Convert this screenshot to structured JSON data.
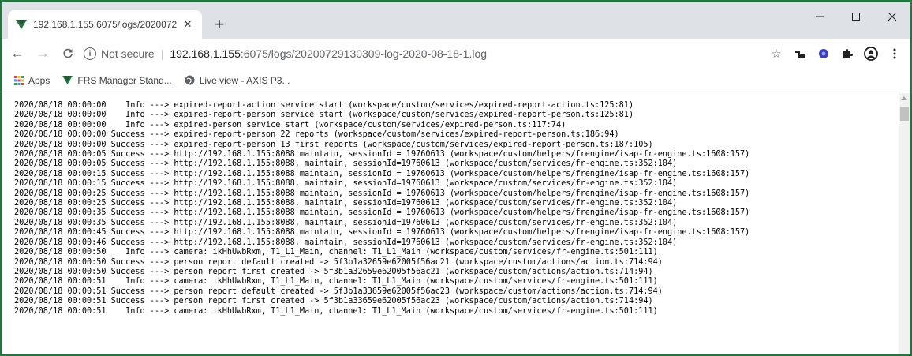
{
  "tab": {
    "title": "192.168.1.155:6075/logs/2020072",
    "close": "✕",
    "new_tab": "+"
  },
  "window_controls": {
    "minimize": "—",
    "maximize": "☐",
    "close": "✕"
  },
  "toolbar": {
    "back": "←",
    "forward": "→",
    "reload": "C",
    "not_secure": "Not secure",
    "separator": "|",
    "url_host": "192.168.1.155",
    "url_path": ":6075/logs/20200729130309-log-2020-08-18-1.log"
  },
  "bookmarks": {
    "apps": "Apps",
    "frs": "FRS Manager Stand...",
    "live": "Live view - AXIS P3..."
  },
  "log_lines": [
    "2020/08/18 00:00:00    Info ---> expired-report-action service start (workspace/custom/services/expired-report-action.ts:125:81)",
    "2020/08/18 00:00:00    Info ---> expired-report-person service start (workspace/custom/services/expired-report-person.ts:125:81)",
    "2020/08/18 00:00:00    Info ---> expired-person service start (workspace/custom/services/expired-person.ts:117:74)",
    "2020/08/18 00:00:00 Success ---> expired-report-person 22 reports (workspace/custom/services/expired-report-person.ts:186:94)",
    "2020/08/18 00:00:00 Success ---> expired-report-person 13 first reports (workspace/custom/services/expired-report-person.ts:187:105)",
    "2020/08/18 00:00:05 Success ---> http://192.168.1.155:8088 maintain, sessionId = 19760613 (workspace/custom/helpers/frengine/isap-fr-engine.ts:1608:157)",
    "2020/08/18 00:00:05 Success ---> http://192.168.1.155:8088, maintain, sessionId=19760613 (workspace/custom/services/fr-engine.ts:352:104)",
    "2020/08/18 00:00:15 Success ---> http://192.168.1.155:8088 maintain, sessionId = 19760613 (workspace/custom/helpers/frengine/isap-fr-engine.ts:1608:157)",
    "2020/08/18 00:00:15 Success ---> http://192.168.1.155:8088, maintain, sessionId=19760613 (workspace/custom/services/fr-engine.ts:352:104)",
    "2020/08/18 00:00:25 Success ---> http://192.168.1.155:8088 maintain, sessionId = 19760613 (workspace/custom/helpers/frengine/isap-fr-engine.ts:1608:157)",
    "2020/08/18 00:00:25 Success ---> http://192.168.1.155:8088, maintain, sessionId=19760613 (workspace/custom/services/fr-engine.ts:352:104)",
    "2020/08/18 00:00:35 Success ---> http://192.168.1.155:8088 maintain, sessionId = 19760613 (workspace/custom/helpers/frengine/isap-fr-engine.ts:1608:157)",
    "2020/08/18 00:00:35 Success ---> http://192.168.1.155:8088, maintain, sessionId=19760613 (workspace/custom/services/fr-engine.ts:352:104)",
    "2020/08/18 00:00:45 Success ---> http://192.168.1.155:8088 maintain, sessionId = 19760613 (workspace/custom/helpers/frengine/isap-fr-engine.ts:1608:157)",
    "2020/08/18 00:00:46 Success ---> http://192.168.1.155:8088, maintain, sessionId=19760613 (workspace/custom/services/fr-engine.ts:352:104)",
    "2020/08/18 00:00:50    Info ---> camera: ikHhUwbRxm, T1_L1_Main, channel: T1_L1_Main (workspace/custom/services/fr-engine.ts:501:111)",
    "2020/08/18 00:00:50 Success ---> person report default created -> 5f3b1a32659e62005f56ac21 (workspace/custom/actions/action.ts:714:94)",
    "2020/08/18 00:00:50 Success ---> person report first created -> 5f3b1a32659e62005f56ac21 (workspace/custom/actions/action.ts:714:94)",
    "2020/08/18 00:00:51    Info ---> camera: ikHhUwbRxm, T1_L1_Main, channel: T1_L1_Main (workspace/custom/services/fr-engine.ts:501:111)",
    "2020/08/18 00:00:51 Success ---> person report default created -> 5f3b1a33659e62005f56ac23 (workspace/custom/actions/action.ts:714:94)",
    "2020/08/18 00:00:51 Success ---> person report first created -> 5f3b1a33659e62005f56ac23 (workspace/custom/actions/action.ts:714:94)",
    "2020/08/18 00:00:51    Info ---> camera: ikHhUwbRxm, T1_L1_Main, channel: T1_L1_Main (workspace/custom/services/fr-engine.ts:501:111)"
  ],
  "colors": {
    "window_border": "#1e7a3c",
    "tabstrip_bg": "#dee1e6",
    "favicon_green": "#1f7a3a",
    "apps_icon_colors": [
      "#ea4335",
      "#fbbc04",
      "#34a853",
      "#4285f4"
    ]
  },
  "icons": {
    "favicon": "vue-logo-icon",
    "info": "info-icon",
    "star": "star-icon",
    "ext1": "extension-icon",
    "ext2": "vpn-globe-icon",
    "puzzle": "puzzle-icon",
    "profile": "profile-icon",
    "menu": "kebab-menu-icon"
  }
}
